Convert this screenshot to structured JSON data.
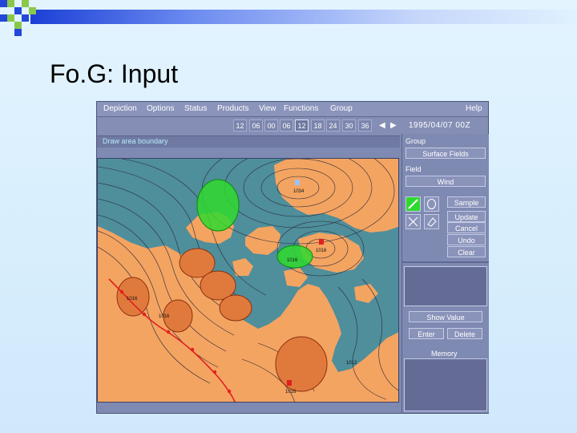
{
  "slide": {
    "title": "Fo.G: Input"
  },
  "menu": [
    "Depiction",
    "Options",
    "Status",
    "Products",
    "View",
    "Functions",
    "Group",
    "Help"
  ],
  "toolbar": {
    "hours": [
      "12",
      "06",
      "00",
      "06",
      "12",
      "18",
      "24",
      "30",
      "36"
    ],
    "active_hour_index": 4,
    "datetime": "1995/04/07 00Z"
  },
  "status": {
    "message": "Draw area boundary"
  },
  "map": {
    "pressure_labels": [
      "1034",
      "1016",
      "1016",
      "1012",
      "1016",
      "1016",
      "1016"
    ]
  },
  "side": {
    "group_label": "Group",
    "group_value": "Surface Fields",
    "field_label": "Field",
    "field_value": "Wind",
    "buttons": [
      "Sample",
      "Update",
      "Cancel",
      "Undo",
      "Clear"
    ],
    "show_value": "Show Value",
    "enter": "Enter",
    "delete": "Delete",
    "memory_label": "Memory"
  },
  "colors": {
    "land": "#f4a461",
    "water": "#4f8e9b",
    "selection": "#2fd92f",
    "front": "#e02020"
  }
}
